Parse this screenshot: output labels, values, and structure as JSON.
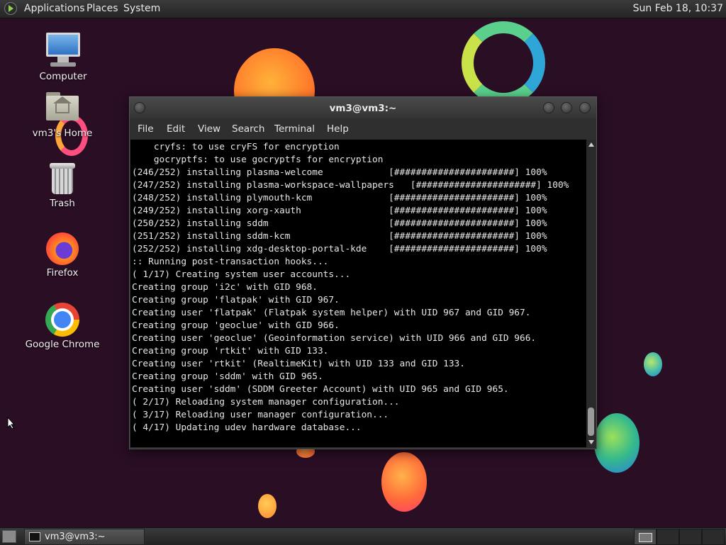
{
  "top_panel": {
    "menus": [
      "Applications",
      "Places",
      "System"
    ],
    "clock": "Sun Feb 18, 10:37"
  },
  "desktop": {
    "icons": [
      {
        "label": "Computer",
        "icon": "computer-icon"
      },
      {
        "label": "vm3's Home",
        "icon": "home-folder-icon"
      },
      {
        "label": "Trash",
        "icon": "trash-icon"
      },
      {
        "label": "Firefox",
        "icon": "firefox-icon"
      },
      {
        "label": "Google Chrome",
        "icon": "chrome-icon"
      }
    ]
  },
  "window": {
    "title": "vm3@vm3:~",
    "menu": [
      "File",
      "Edit",
      "View",
      "Search",
      "Terminal",
      "Help"
    ],
    "terminal_lines": [
      "    cryfs: to use cryFS for encryption",
      "    gocryptfs: to use gocryptfs for encryption",
      "(246/252) installing plasma-welcome            [######################] 100%",
      "(247/252) installing plasma-workspace-wallpapers   [######################] 100%",
      "(248/252) installing plymouth-kcm              [######################] 100%",
      "(249/252) installing xorg-xauth                [######################] 100%",
      "(250/252) installing sddm                      [######################] 100%",
      "(251/252) installing sddm-kcm                  [######################] 100%",
      "(252/252) installing xdg-desktop-portal-kde    [######################] 100%",
      ":: Running post-transaction hooks...",
      "( 1/17) Creating system user accounts...",
      "Creating group 'i2c' with GID 968.",
      "Creating group 'flatpak' with GID 967.",
      "Creating user 'flatpak' (Flatpak system helper) with UID 967 and GID 967.",
      "Creating group 'geoclue' with GID 966.",
      "Creating user 'geoclue' (Geoinformation service) with UID 966 and GID 966.",
      "Creating group 'rtkit' with GID 133.",
      "Creating user 'rtkit' (RealtimeKit) with UID 133 and GID 133.",
      "Creating group 'sddm' with GID 965.",
      "Creating user 'sddm' (SDDM Greeter Account) with UID 965 and GID 965.",
      "( 2/17) Reloading system manager configuration...",
      "( 3/17) Reloading user manager configuration...",
      "( 4/17) Updating udev hardware database..."
    ]
  },
  "bottom_panel": {
    "task_label": "vm3@vm3:~"
  }
}
